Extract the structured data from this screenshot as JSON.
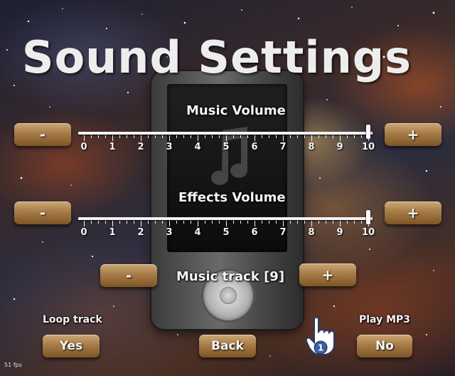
{
  "title": "Sound Settings",
  "music_volume": {
    "label": "Music Volume",
    "minus_label": "-",
    "plus_label": "+",
    "value": 10,
    "min": 0,
    "max": 10,
    "ticks": [
      "0",
      "1",
      "2",
      "3",
      "4",
      "5",
      "6",
      "7",
      "8",
      "9",
      "10"
    ]
  },
  "effects_volume": {
    "label": "Effects Volume",
    "minus_label": "-",
    "plus_label": "+",
    "value": 10,
    "min": 0,
    "max": 10,
    "ticks": [
      "0",
      "1",
      "2",
      "3",
      "4",
      "5",
      "6",
      "7",
      "8",
      "9",
      "10"
    ]
  },
  "music_track": {
    "label": "Music track [9]",
    "minus_label": "-",
    "plus_label": "+"
  },
  "loop_track": {
    "label": "Loop track",
    "button_label": "Yes"
  },
  "play_mp3": {
    "label": "Play MP3",
    "button_label": "No"
  },
  "back_label": "Back",
  "cursor_badge": "1",
  "fps_text": "51 fps",
  "colors": {
    "button_top": "#caa878",
    "button_bottom": "#7c5526",
    "text": "#f3f3f3"
  }
}
